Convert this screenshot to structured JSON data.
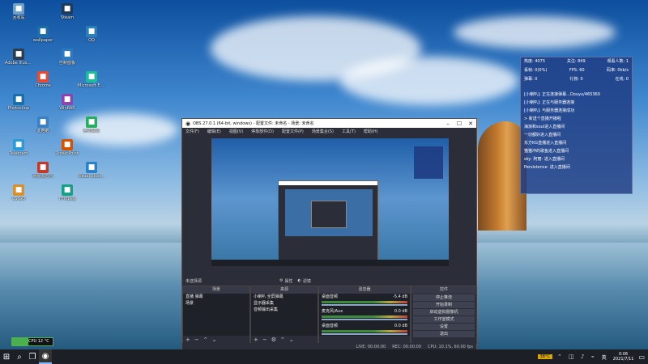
{
  "desktop": {
    "icons": [
      {
        "label": "回收站",
        "icon": "recycle-bin-icon",
        "color": "#6fa0c8"
      },
      {
        "label": "Adobe Illustrator",
        "icon": "app-icon",
        "color": "#2c3e50"
      },
      {
        "label": "Photoshop",
        "icon": "app-icon",
        "color": "#1b6fa8"
      },
      {
        "label": "Telegram",
        "icon": "app-icon",
        "color": "#2b9bd8"
      },
      {
        "label": "CS:GO",
        "icon": "game-icon",
        "color": "#d98f2b"
      },
      {
        "label": "wallpaper",
        "icon": "app-icon",
        "color": "#1b6fa8"
      },
      {
        "label": "Chrome",
        "icon": "browser-icon",
        "color": "#e34a33"
      },
      {
        "label": "此电脑",
        "icon": "computer-icon",
        "color": "#3b7fc4"
      },
      {
        "label": "网易云音乐",
        "icon": "app-icon",
        "color": "#c0392b"
      },
      {
        "label": "Steam",
        "icon": "game-icon",
        "color": "#1f3b5b"
      },
      {
        "label": "控制面板",
        "icon": "app-icon",
        "color": "#2c7abf"
      },
      {
        "label": "WinRAR",
        "icon": "archive-icon",
        "color": "#8e44ad"
      },
      {
        "label": "PowerPoint",
        "icon": "app-icon",
        "color": "#d35400"
      },
      {
        "label": "FFmpeg",
        "icon": "app-icon",
        "color": "#16a085"
      },
      {
        "label": "QQ",
        "icon": "app-icon",
        "color": "#2980b9"
      },
      {
        "label": "Microsoft Edge",
        "icon": "browser-icon",
        "color": "#1abc9c"
      },
      {
        "label": "腾讯会议",
        "icon": "app-icon",
        "color": "#27ae60"
      },
      {
        "label": "Visual Studio Code",
        "icon": "app-icon",
        "color": "#2c82c9"
      }
    ]
  },
  "stats": {
    "title_left": "热度: 4075",
    "title_mid": "关注: 849",
    "title_right": "观看人数: 1",
    "row2_left": "丢帧: 0(0%)",
    "row2_mid": "FPS: 60",
    "row2_right": "码率: 0kb/s",
    "row3_left": "弹幕: 0",
    "row3_mid": "礼物: 0",
    "row3_right": "在线: 0",
    "chat": [
      "[小喇叭]: 正在连接弹幕...Douyu/465360",
      "[小喇叭]: 正在与服务器连接",
      "[小喇叭]: 与服务器连接成功",
      "> 新送个直播开播啦",
      "海浪和soul进入直播间",
      "一切都好进入直播间",
      "东方KG直播进入直播间",
      "猫猫冲的歌鱼进入直播间",
      "sky· 阿丽- 进入直播间",
      "Persistence· 进入直播间"
    ]
  },
  "obs": {
    "title": "OBS 27.0.1 (64-bit, windows) - 配置文件: 未命名 - 场景: 未命名",
    "menu": [
      "文件(F)",
      "编辑(E)",
      "视图(V)",
      "停靠部件(D)",
      "配置文件(P)",
      "场景集合(S)",
      "工具(T)",
      "帮助(H)"
    ],
    "source_bar": {
      "status": "未选择源",
      "properties": "属性",
      "filters": "滤镜"
    },
    "docks": {
      "scenes": {
        "title": "场景",
        "items": [
          "直播 弹幕",
          "场景"
        ]
      },
      "sources": {
        "title": "来源",
        "items": [
          "小喇叭 全屏弹幕",
          "显示器采集",
          "音频输出采集"
        ]
      },
      "mixer": {
        "title": "混音器",
        "tracks": [
          {
            "name": "桌面音频",
            "db": "-5.4 dB"
          },
          {
            "name": "麦克风/Aux",
            "db": "0.0 dB"
          },
          {
            "name": "桌面音频",
            "db": "0.0 dB"
          }
        ]
      },
      "controls": {
        "title": "控件",
        "buttons": [
          "停止推流",
          "开始录制",
          "启动虚拟摄像机",
          "工作室模式",
          "设置",
          "退出"
        ]
      }
    },
    "statusbar": {
      "live": "LIVE: 00:00:00",
      "rec": "REC: 00:00:00",
      "cpu": "CPU: 10.1%, 60.00 fps"
    }
  },
  "cpu_meter": {
    "label": "CPU 12 °C",
    "level": 0.4
  },
  "taskbar": {
    "icons": [
      "windows-start-icon",
      "search-icon",
      "task-view-icon",
      "obs-icon"
    ],
    "tray": {
      "ime": "英",
      "temp": "38°C",
      "time": "0:06",
      "date": "2021/7/11"
    }
  }
}
